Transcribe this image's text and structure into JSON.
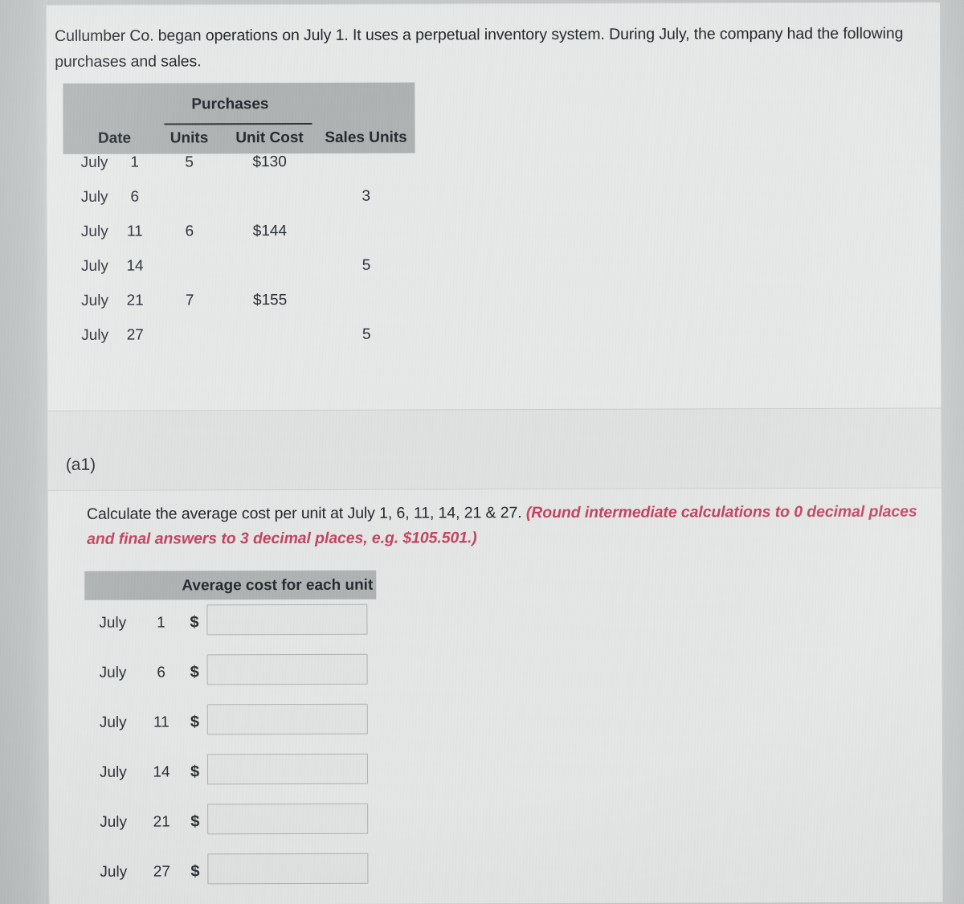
{
  "prompt": "Cullumber Co. began operations on July 1. It uses a perpetual inventory system. During July, the company had the following purchases and sales.",
  "purchases_table": {
    "group_header": "Purchases",
    "columns": [
      "Date",
      "Units",
      "Unit Cost",
      "Sales Units"
    ],
    "rows": [
      {
        "month": "July",
        "day": "1",
        "units": "5",
        "unit_cost": "$130",
        "sales_units": ""
      },
      {
        "month": "July",
        "day": "6",
        "units": "",
        "unit_cost": "",
        "sales_units": "3"
      },
      {
        "month": "July",
        "day": "11",
        "units": "6",
        "unit_cost": "$144",
        "sales_units": ""
      },
      {
        "month": "July",
        "day": "14",
        "units": "",
        "unit_cost": "",
        "sales_units": "5"
      },
      {
        "month": "July",
        "day": "21",
        "units": "7",
        "unit_cost": "$155",
        "sales_units": ""
      },
      {
        "month": "July",
        "day": "27",
        "units": "",
        "unit_cost": "",
        "sales_units": "5"
      }
    ]
  },
  "part": {
    "label": "(a1)",
    "instruction_plain": "Calculate the average cost per unit at July 1, 6, 11, 14, 21 & 27.",
    "instruction_emphasis": "(Round intermediate calculations to 0 decimal places and final answers to 3 decimal places, e.g. $105.501.)",
    "emphasis_color": "#c3435f"
  },
  "answer_table": {
    "header": "Average cost for each unit",
    "currency_symbol": "$",
    "rows": [
      {
        "month": "July",
        "day": "1",
        "value": ""
      },
      {
        "month": "July",
        "day": "6",
        "value": ""
      },
      {
        "month": "July",
        "day": "11",
        "value": ""
      },
      {
        "month": "July",
        "day": "14",
        "value": ""
      },
      {
        "month": "July",
        "day": "21",
        "value": ""
      },
      {
        "month": "July",
        "day": "27",
        "value": ""
      }
    ]
  },
  "theme": {
    "page_background": "#e3e5e5",
    "header_gray": "#aeb2b2",
    "text_color": "#22262b"
  }
}
